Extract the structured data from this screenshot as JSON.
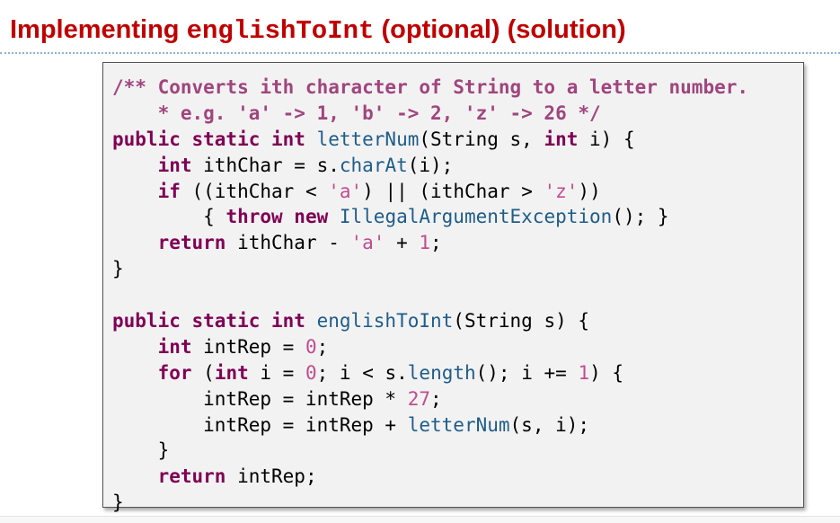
{
  "slide": {
    "title_prefix": "Implementing ",
    "title_code": "englishToInt",
    "title_suffix": " (optional) (solution)"
  },
  "code": {
    "lines": [
      [
        {
          "t": "comment",
          "v": "/** Converts ith character of String to a letter number."
        }
      ],
      [
        {
          "t": "comment",
          "v": "    * e.g. 'a' -> 1, 'b' -> 2, 'z' -> 26 */"
        }
      ],
      [
        {
          "t": "kw",
          "v": "public static int "
        },
        {
          "t": "method",
          "v": "letterNum"
        },
        {
          "t": "plain",
          "v": "(String s, "
        },
        {
          "t": "kw",
          "v": "int"
        },
        {
          "t": "plain",
          "v": " i) {"
        }
      ],
      [
        {
          "t": "plain",
          "v": "    "
        },
        {
          "t": "kw",
          "v": "int"
        },
        {
          "t": "plain",
          "v": " ithChar = s."
        },
        {
          "t": "method",
          "v": "charAt"
        },
        {
          "t": "plain",
          "v": "(i);"
        }
      ],
      [
        {
          "t": "plain",
          "v": "    "
        },
        {
          "t": "kw",
          "v": "if"
        },
        {
          "t": "plain",
          "v": " ((ithChar < "
        },
        {
          "t": "str",
          "v": "'a'"
        },
        {
          "t": "plain",
          "v": ") || (ithChar > "
        },
        {
          "t": "str",
          "v": "'z'"
        },
        {
          "t": "plain",
          "v": "))"
        }
      ],
      [
        {
          "t": "plain",
          "v": "        { "
        },
        {
          "t": "kw",
          "v": "throw new "
        },
        {
          "t": "method",
          "v": "IllegalArgumentException"
        },
        {
          "t": "plain",
          "v": "(); }"
        }
      ],
      [
        {
          "t": "plain",
          "v": "    "
        },
        {
          "t": "kw",
          "v": "return"
        },
        {
          "t": "plain",
          "v": " ithChar - "
        },
        {
          "t": "str",
          "v": "'a'"
        },
        {
          "t": "plain",
          "v": " + "
        },
        {
          "t": "num",
          "v": "1"
        },
        {
          "t": "plain",
          "v": ";"
        }
      ],
      [
        {
          "t": "plain",
          "v": "}"
        }
      ],
      [
        {
          "t": "plain",
          "v": ""
        }
      ],
      [
        {
          "t": "kw",
          "v": "public static int "
        },
        {
          "t": "method",
          "v": "englishToInt"
        },
        {
          "t": "plain",
          "v": "(String s) {"
        }
      ],
      [
        {
          "t": "plain",
          "v": "    "
        },
        {
          "t": "kw",
          "v": "int"
        },
        {
          "t": "plain",
          "v": " intRep = "
        },
        {
          "t": "num",
          "v": "0"
        },
        {
          "t": "plain",
          "v": ";"
        }
      ],
      [
        {
          "t": "plain",
          "v": "    "
        },
        {
          "t": "kw",
          "v": "for"
        },
        {
          "t": "plain",
          "v": " ("
        },
        {
          "t": "kw",
          "v": "int"
        },
        {
          "t": "plain",
          "v": " i = "
        },
        {
          "t": "num",
          "v": "0"
        },
        {
          "t": "plain",
          "v": "; i < s."
        },
        {
          "t": "method",
          "v": "length"
        },
        {
          "t": "plain",
          "v": "(); i += "
        },
        {
          "t": "num",
          "v": "1"
        },
        {
          "t": "plain",
          "v": ") {"
        }
      ],
      [
        {
          "t": "plain",
          "v": "        intRep = intRep * "
        },
        {
          "t": "num",
          "v": "27"
        },
        {
          "t": "plain",
          "v": ";"
        }
      ],
      [
        {
          "t": "plain",
          "v": "        intRep = intRep + "
        },
        {
          "t": "method",
          "v": "letterNum"
        },
        {
          "t": "plain",
          "v": "(s, i);"
        }
      ],
      [
        {
          "t": "plain",
          "v": "    }"
        }
      ],
      [
        {
          "t": "plain",
          "v": "    "
        },
        {
          "t": "kw",
          "v": "return"
        },
        {
          "t": "plain",
          "v": " intRep;"
        }
      ],
      [
        {
          "t": "plain",
          "v": "}"
        }
      ]
    ]
  },
  "colors": {
    "title": "#c00000",
    "keyword": "#7f0055",
    "comment": "#a0457d",
    "method": "#1f5c8a",
    "literal": "#c24c8e",
    "box_background": "#f2f2f2",
    "rule": "#8fb3d9"
  }
}
